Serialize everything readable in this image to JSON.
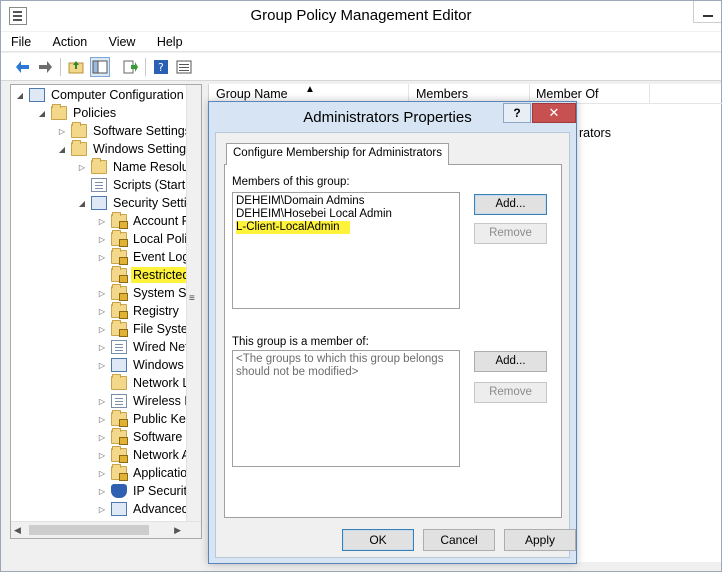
{
  "window": {
    "title": "Group Policy Management Editor"
  },
  "menu": [
    "File",
    "Action",
    "View",
    "Help"
  ],
  "toolbar": {
    "icons": [
      "back-arrow-icon",
      "forward-arrow-icon",
      "up-folder-icon",
      "show-hide-tree-icon",
      "export-list-icon",
      "help-icon",
      "properties-icon"
    ]
  },
  "tree": {
    "nodes": [
      {
        "label": "Computer Configuration",
        "icon": "computer-icon"
      },
      {
        "label": "Policies",
        "icon": "folder-icon"
      },
      {
        "label": "Software Settings",
        "icon": "folder-icon"
      },
      {
        "label": "Windows Settings",
        "icon": "folder-icon"
      },
      {
        "label": "Name Resolut",
        "icon": "folder-icon"
      },
      {
        "label": "Scripts (Startu",
        "icon": "script-icon"
      },
      {
        "label": "Security Settin",
        "icon": "security-icon"
      },
      {
        "label": "Account P",
        "icon": "lock-folder-icon"
      },
      {
        "label": "Local Polic",
        "icon": "lock-folder-icon"
      },
      {
        "label": "Event Log",
        "icon": "lock-folder-icon"
      },
      {
        "label": "Restricted",
        "icon": "lock-folder-icon"
      },
      {
        "label": "System Se",
        "icon": "lock-folder-icon"
      },
      {
        "label": "Registry",
        "icon": "lock-folder-icon"
      },
      {
        "label": "File Systen",
        "icon": "lock-folder-icon"
      },
      {
        "label": "Wired Net",
        "icon": "network-icon"
      },
      {
        "label": "Windows I",
        "icon": "firewall-icon"
      },
      {
        "label": "Network L",
        "icon": "folder-icon"
      },
      {
        "label": "Wireless N",
        "icon": "wireless-icon"
      },
      {
        "label": "Public Key",
        "icon": "lock-folder-icon"
      },
      {
        "label": "Software R",
        "icon": "lock-folder-icon"
      },
      {
        "label": "Network A",
        "icon": "lock-folder-icon"
      },
      {
        "label": "Applicatio",
        "icon": "lock-folder-icon"
      },
      {
        "label": "IP Security",
        "icon": "shield-icon"
      },
      {
        "label": "Advanced",
        "icon": "firewall-icon"
      }
    ]
  },
  "list": {
    "columns": [
      "Group Name",
      "Members",
      "Member Of"
    ],
    "row_fragment": "rators"
  },
  "dialog": {
    "title": "Administrators Properties",
    "help": "?",
    "close": "✕",
    "tab": "Configure Membership for Administrators",
    "members_label": "Members of this group:",
    "members": [
      "DEHEIM\\Domain Admins",
      "DEHEIM\\Hosebei Local Admin",
      "L-Client-LocalAdmin"
    ],
    "memberof_label": "This group is a member of:",
    "memberof_hint": "<The groups to which this group belongs should not be modified>",
    "add": "Add...",
    "remove": "Remove",
    "ok": "OK",
    "cancel": "Cancel",
    "apply": "Apply"
  },
  "colors": {
    "highlight": "#fff23a",
    "close_button": "#c75050",
    "dialog_frame": "#d6e4f3"
  }
}
